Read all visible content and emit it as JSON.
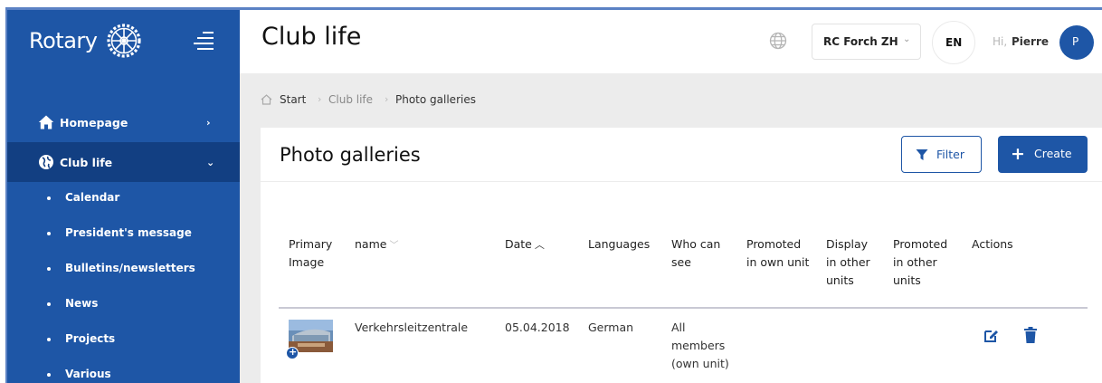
{
  "sidebar": {
    "logo_text": "Rotary",
    "nav": [
      {
        "label": "Homepage",
        "chevron": "›",
        "icon": "home-icon"
      },
      {
        "label": "Club life",
        "chevron": "⌄",
        "icon": "globe-icon"
      }
    ],
    "sub_items": [
      {
        "label": "Calendar"
      },
      {
        "label": "President's message"
      },
      {
        "label": "Bulletins/newsletters"
      },
      {
        "label": "News"
      },
      {
        "label": "Projects"
      },
      {
        "label": "Various"
      }
    ]
  },
  "header": {
    "title": "Club life",
    "club": "RC Forch ZH",
    "language": "EN",
    "greeting": "Hi,",
    "user_name": "Pierre",
    "avatar_initial": "P"
  },
  "breadcrumb": [
    "Start",
    "Club life",
    "Photo galleries"
  ],
  "main": {
    "title": "Photo galleries",
    "filter_label": "Filter",
    "create_label": "Create",
    "columns": [
      "Primary Image",
      "name",
      "Date",
      "Languages",
      "Who can see",
      "Promoted in own unit",
      "Display in other units",
      "Promoted in other units",
      "Actions"
    ],
    "rows": [
      {
        "name": "Verkehrsleitzentrale",
        "date": "05.04.2018",
        "languages": "German",
        "who_can_see": "All members (own unit)",
        "promoted_own": "",
        "display_other": "",
        "promoted_other": ""
      }
    ]
  },
  "colors": {
    "brand_blue": "#1e56a6",
    "sidebar_active": "#123f82",
    "page_bg": "#ececec"
  }
}
